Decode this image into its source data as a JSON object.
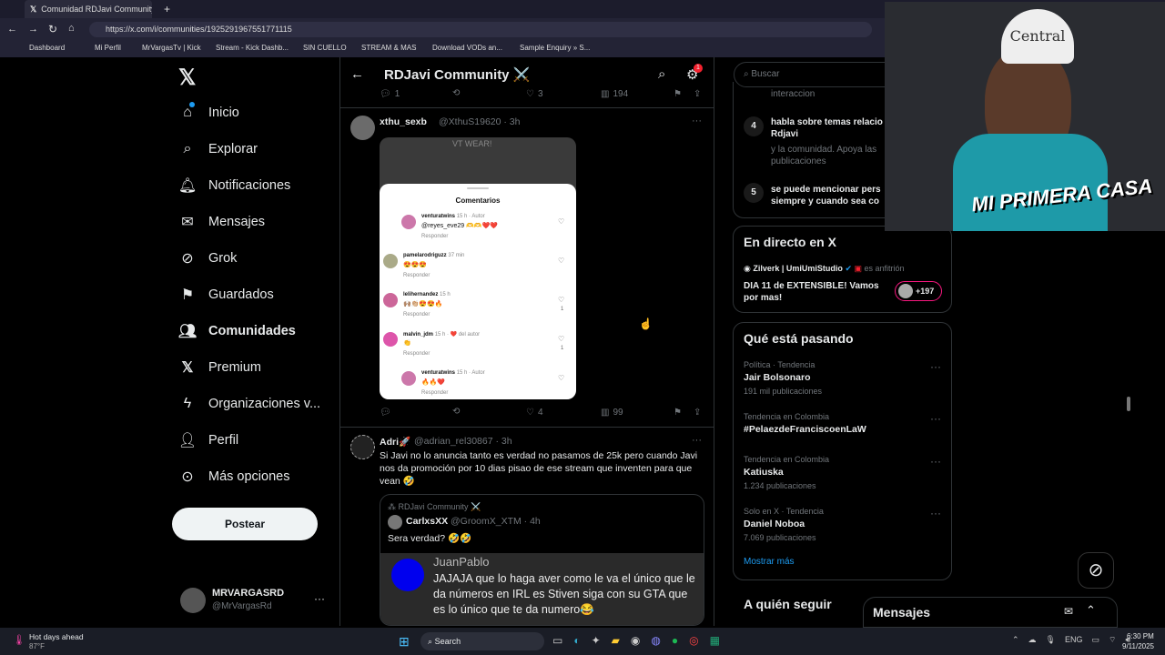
{
  "browser": {
    "tab_title": "Comunidad RDJavi Community",
    "url": "https://x.com/i/communities/1925291967551771115",
    "bookmarks": [
      "Dashboard",
      "Mi Perfil",
      "MrVargasTv | Kick",
      "Stream - Kick Dashb...",
      "SIN CUELLO",
      "STREAM & MAS",
      "Download VODs an...",
      "Sample Enquiry » S..."
    ]
  },
  "sidebar": {
    "items": [
      "Inicio",
      "Explorar",
      "Notificaciones",
      "Mensajes",
      "Grok",
      "Guardados",
      "Comunidades",
      "Premium",
      "Organizaciones v...",
      "Perfil",
      "Más opciones"
    ],
    "post_button": "Postear",
    "user_name": "MRVARGASRD",
    "user_handle": "@MrVargasRd"
  },
  "header": {
    "title": "RDJavi Community ⚔️",
    "badge": "1"
  },
  "post1": {
    "stats": {
      "replies": "1",
      "likes": "3",
      "views": "194"
    }
  },
  "post2": {
    "name": "xthu_sexb",
    "handle": "@XthuS19620 · 3h",
    "img_top": "VT WEAR!",
    "comments_title": "Comentarios",
    "comments": [
      {
        "user": "venturatwins",
        "meta": "15 h · Autor",
        "text": "@reyes_eve29 🫶🫶❤️❤️",
        "reply": "Responder",
        "likes": ""
      },
      {
        "user": "pamelarodriguzz",
        "meta": "37 min",
        "text": "😍😍😍",
        "reply": "Responder",
        "likes": ""
      },
      {
        "user": "lelihernandez",
        "meta": "15 h",
        "text": "🙌🏽👏🏼😍😍🔥",
        "reply": "Responder",
        "likes": "1"
      },
      {
        "user": "malvin_jdm",
        "meta": "15 h · ❤️ del autor",
        "text": "👏",
        "reply": "Responder",
        "likes": "1"
      },
      {
        "user": "venturatwins",
        "meta": "15 h · Autor",
        "text": "🔥🔥❤️",
        "reply": "Responder",
        "likes": ""
      }
    ],
    "stats": {
      "replies": "",
      "likes": "4",
      "views": "99"
    }
  },
  "post3": {
    "name": "Adri🚀",
    "handle": "@adrian_rel30867 · 3h",
    "text": "Si Javi no lo anuncia tanto es verdad no pasamos de 25k pero cuando Javi nos da promoción por 10 dias pisao de ese stream que inventen para que vean 🤣",
    "quote": {
      "community": "RDJavi Community ⚔️",
      "name": "CarlxsXX",
      "handle": "@GroomX_XTM · 4h",
      "text": "Sera verdad? 🤣🤣",
      "inner_name": "JuanPablo",
      "inner_text": "JAJAJA que lo haga aver como le va el único que le da números en IRL es Stiven siga con su GTA que es lo único que te da numero😂"
    }
  },
  "right": {
    "search_placeholder": "Buscar",
    "rules": [
      {
        "num": "",
        "title": "",
        "desc": "interaccion"
      },
      {
        "num": "4",
        "title": "habla sobre temas relacio Rdjavi",
        "desc": "y la comunidad. Apoya las publicaciones"
      },
      {
        "num": "5",
        "title": "se puede mencionar pers siempre y cuando sea co",
        "desc": ""
      }
    ],
    "live": {
      "title": "En directo en X",
      "host": "Zilverk | UmiUmiStudio",
      "host_role": "es anfitrión",
      "desc": "DIA 11 de EXTENSIBLE! Vamos por mas!",
      "count": "+197"
    },
    "trends_title": "Qué está pasando",
    "trends": [
      {
        "cat": "Política · Tendencia",
        "name": "Jair Bolsonaro",
        "posts": "191 mil publicaciones"
      },
      {
        "cat": "Tendencia en Colombia",
        "name": "#PelaezdeFranciscoenLaW",
        "posts": ""
      },
      {
        "cat": "Tendencia en Colombia",
        "name": "Katiuska",
        "posts": "1.234 publicaciones"
      },
      {
        "cat": "Solo en X · Tendencia",
        "name": "Daniel Noboa",
        "posts": "7.069 publicaciones"
      }
    ],
    "show_more": "Mostrar más",
    "who_follow": "A quién seguir",
    "messages": "Mensajes"
  },
  "webcam": {
    "cap_text": "Central",
    "overlay": "MI PRIMERA CASA"
  },
  "taskbar": {
    "weather_title": "Hot days ahead",
    "weather_temp": "87°F",
    "search": "Search",
    "lang": "ENG",
    "time": "6:30 PM",
    "date": "9/11/2025"
  }
}
